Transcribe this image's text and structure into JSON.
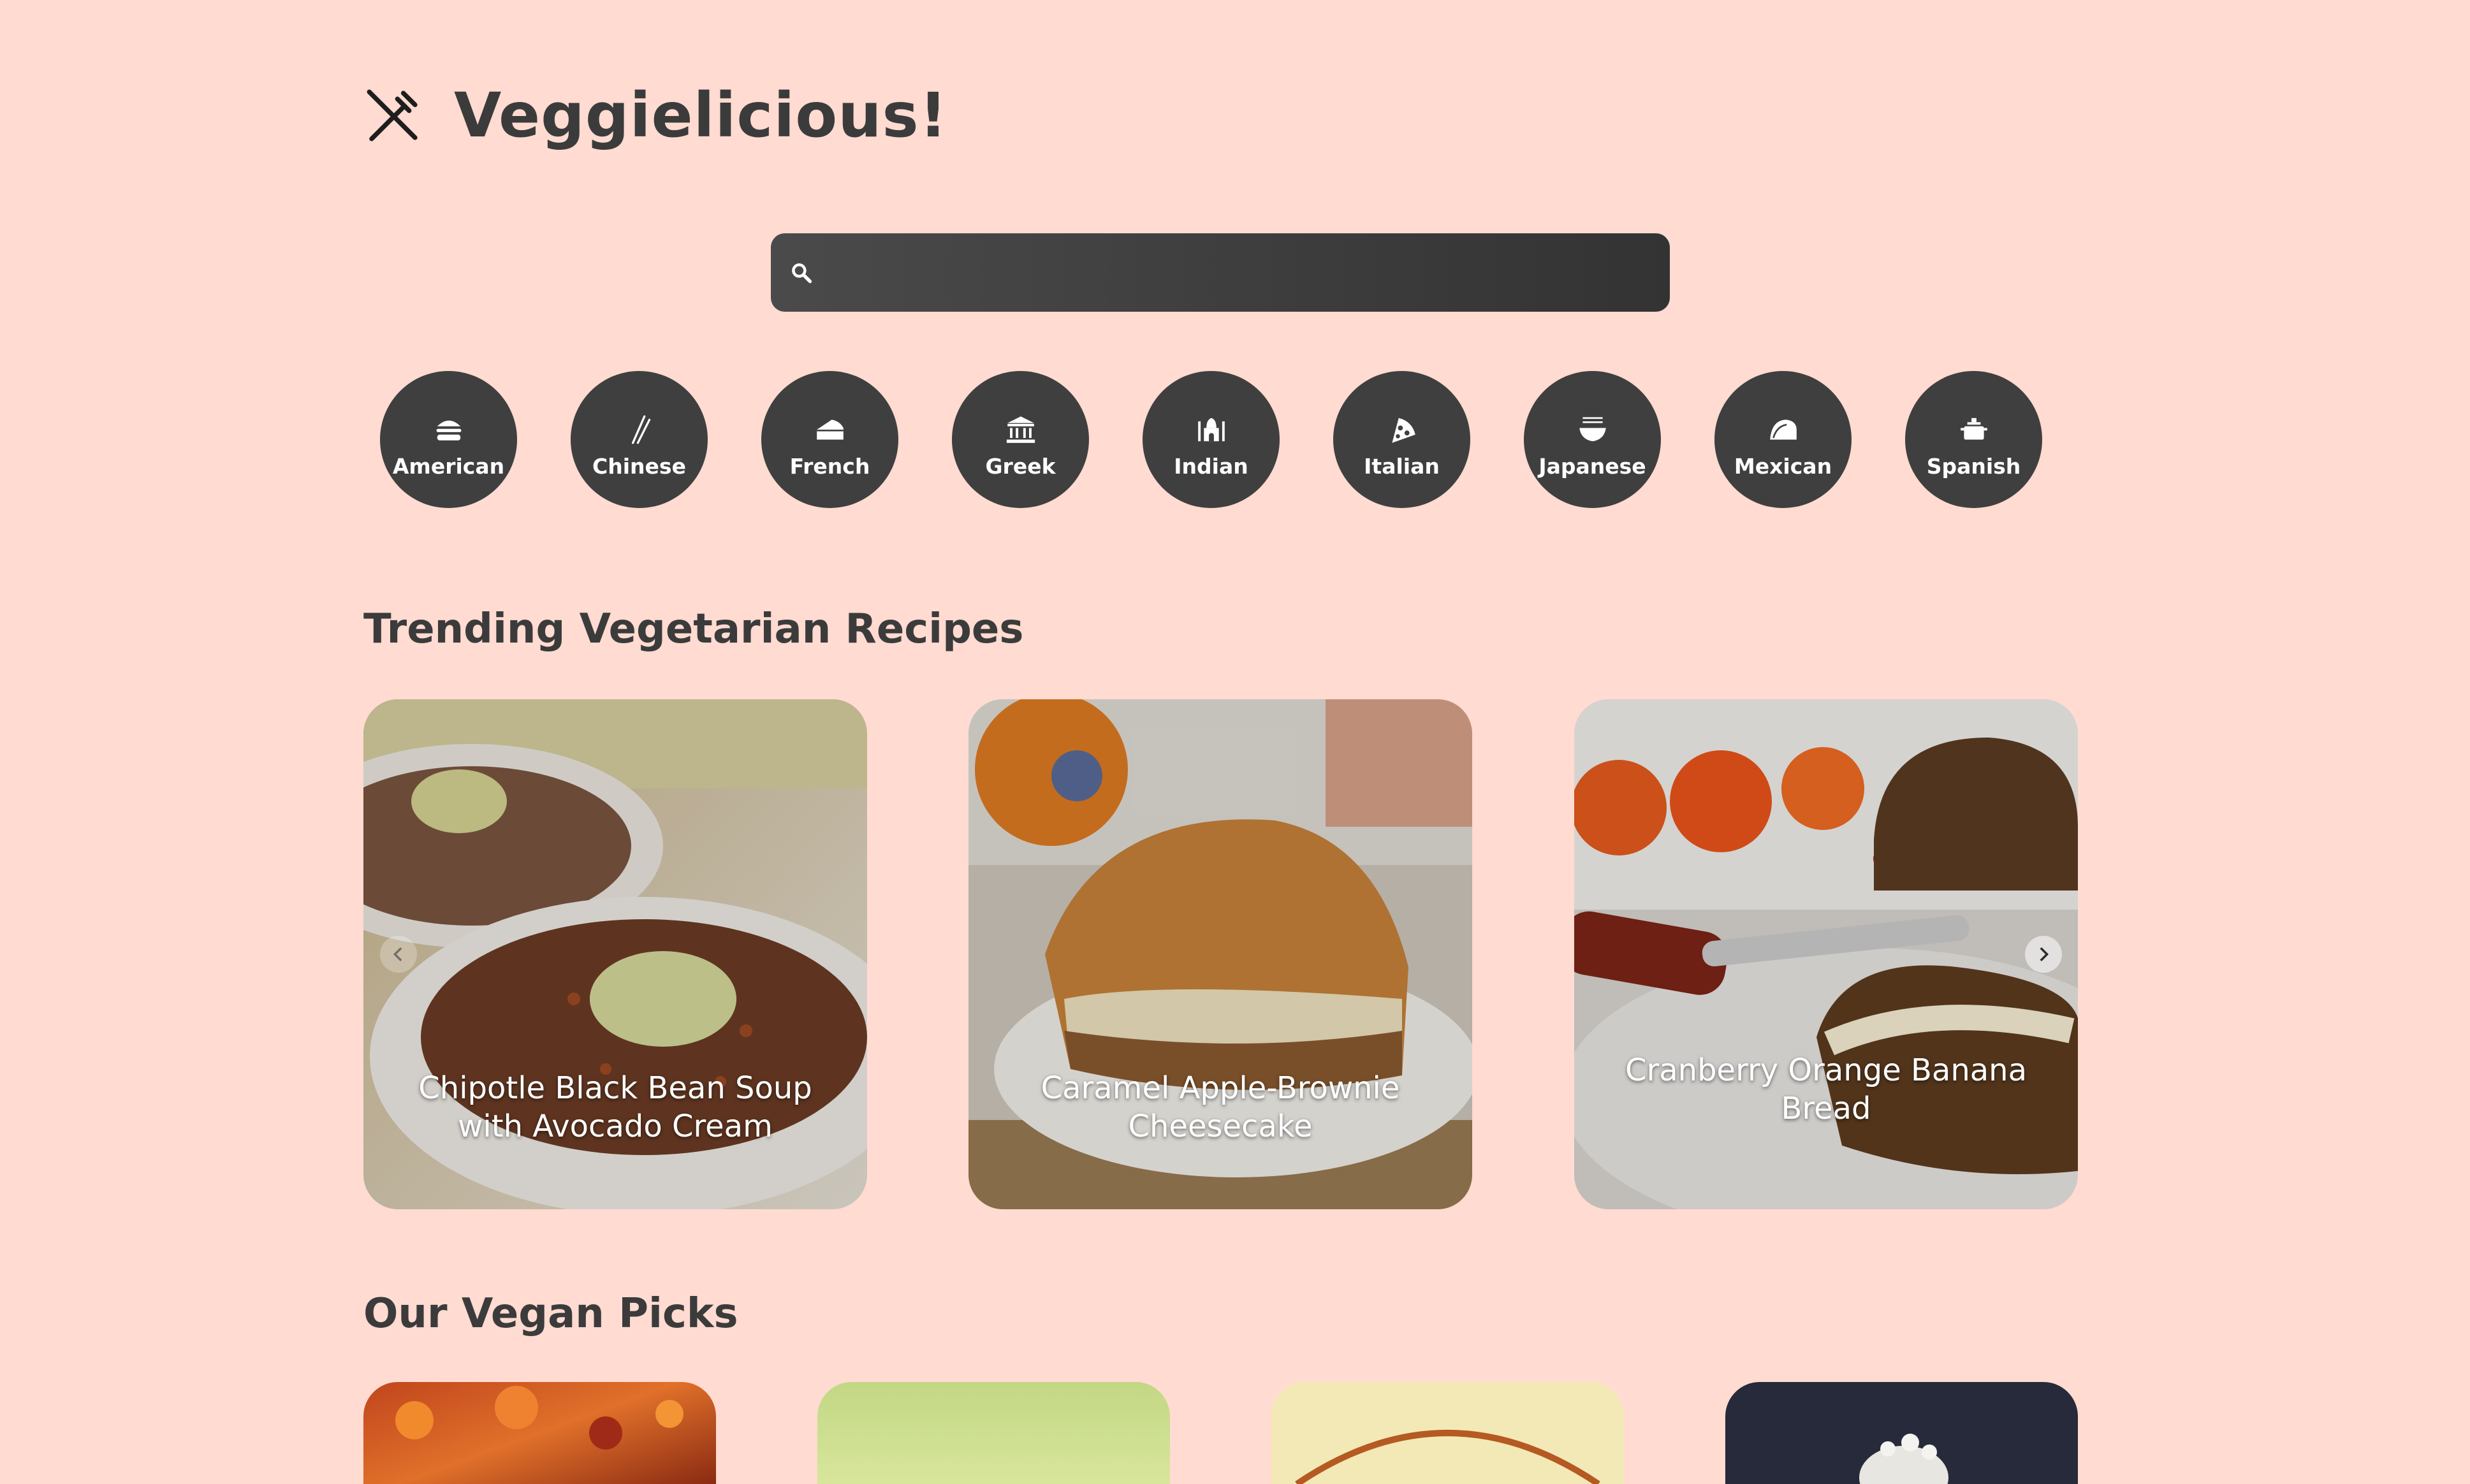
{
  "header": {
    "title": "Veggielicious!"
  },
  "search": {
    "placeholder": "",
    "value": ""
  },
  "cuisines": [
    {
      "label": "American",
      "icon": "burger-icon"
    },
    {
      "label": "Chinese",
      "icon": "chopsticks-icon"
    },
    {
      "label": "French",
      "icon": "cheese-icon"
    },
    {
      "label": "Greek",
      "icon": "temple-icon"
    },
    {
      "label": "Indian",
      "icon": "taj-mahal-icon"
    },
    {
      "label": "Italian",
      "icon": "pizza-icon"
    },
    {
      "label": "Japanese",
      "icon": "ramen-bowl-icon"
    },
    {
      "label": "Mexican",
      "icon": "taco-icon"
    },
    {
      "label": "Spanish",
      "icon": "paella-pot-icon"
    }
  ],
  "trending": {
    "title": "Trending Vegetarian Recipes",
    "recipes": [
      {
        "name": "Chipotle Black Bean Soup with Avocado Cream"
      },
      {
        "name": "Caramel Apple-Brownie Cheesecake"
      },
      {
        "name": "Cranberry Orange Banana Bread"
      }
    ]
  },
  "vegan": {
    "title": "Our Vegan Picks"
  },
  "colors": {
    "background": "#ffdbd1",
    "button": "#3f3f3f",
    "text": "#3b3b3b"
  }
}
